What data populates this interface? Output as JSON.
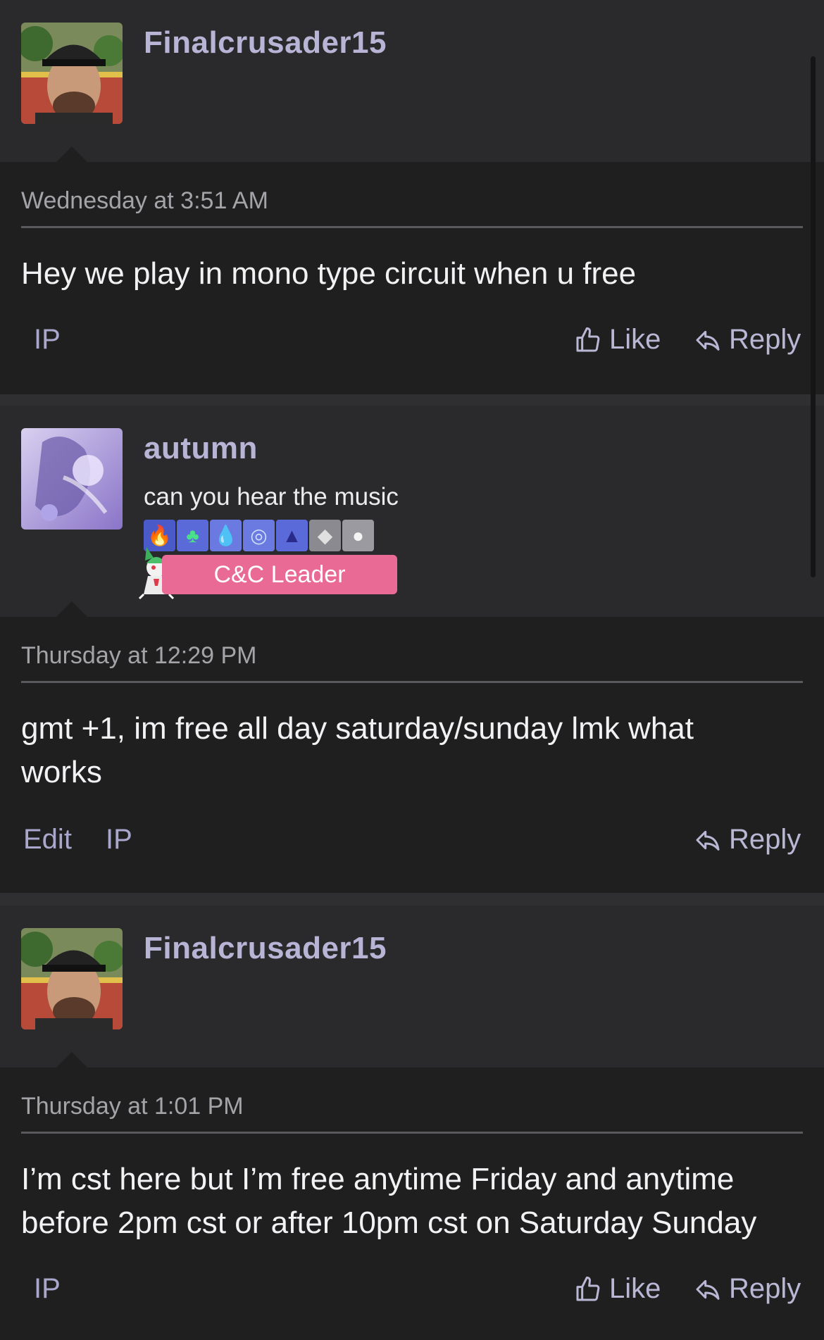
{
  "posts": [
    {
      "username": "Finalcrusader15",
      "timestamp": "Wednesday at 3:51 AM",
      "message": "Hey we play in mono type circuit when u free",
      "actions": {
        "left": [
          "IP"
        ],
        "like": "Like",
        "reply": "Reply"
      }
    },
    {
      "username": "autumn",
      "user_title": "can you hear the music",
      "badges": [
        "fire-badge",
        "grass-badge",
        "water-badge",
        "steel-badge",
        "dark-badge",
        "rock-badge",
        "normal-badge"
      ],
      "role": "C&C Leader",
      "timestamp": "Thursday at 12:29 PM",
      "message": "gmt +1, im free all day saturday/sunday lmk what works",
      "actions": {
        "left": [
          "Edit",
          "IP"
        ],
        "reply": "Reply"
      }
    },
    {
      "username": "Finalcrusader15",
      "timestamp": "Thursday at 1:01 PM",
      "message": "I’m cst here but I’m free anytime Friday and anytime before 2pm cst or after 10pm cst on Saturday Sunday",
      "actions": {
        "left": [
          "IP"
        ],
        "like": "Like",
        "reply": "Reply"
      }
    }
  ],
  "colors": {
    "accent": "#b8b4d6",
    "role_badge": "#e86a95",
    "background": "#1f1f20",
    "header_background": "#2a2a2c"
  },
  "icons": [
    "thumbs-up-icon",
    "reply-arrow-icon"
  ]
}
